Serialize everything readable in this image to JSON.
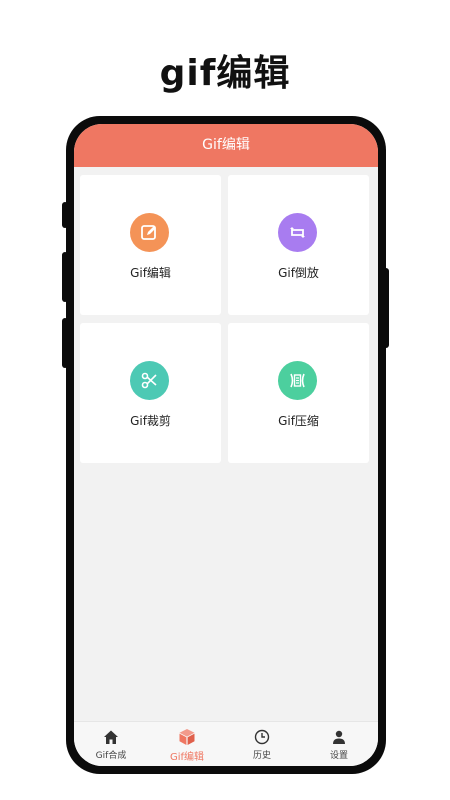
{
  "promo": {
    "title": "gif编辑"
  },
  "app": {
    "header_title": "Gif编辑"
  },
  "features": [
    {
      "label": "Gif编辑",
      "color": "#f49357",
      "icon": "edit-icon"
    },
    {
      "label": "Gif倒放",
      "color": "#a87cf0",
      "icon": "reverse-loop-icon"
    },
    {
      "label": "Gif裁剪",
      "color": "#4dc9b4",
      "icon": "scissors-icon"
    },
    {
      "label": "Gif压缩",
      "color": "#4ccf9e",
      "icon": "compress-icon"
    }
  ],
  "tabs": [
    {
      "label": "Gif合成",
      "icon": "home-icon",
      "active": false
    },
    {
      "label": "Gif编辑",
      "icon": "cube-icon",
      "active": true
    },
    {
      "label": "历史",
      "icon": "clock-icon",
      "active": false
    },
    {
      "label": "设置",
      "icon": "user-icon",
      "active": false
    }
  ],
  "colors": {
    "accent": "#ef7762",
    "background": "#f2f2f2"
  }
}
